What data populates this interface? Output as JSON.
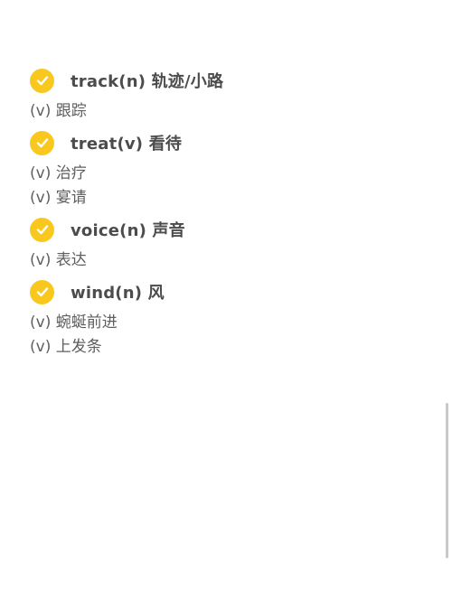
{
  "entries": [
    {
      "word": "track(n) 轨迹/小路",
      "senses": [
        "(v) 跟踪"
      ]
    },
    {
      "word": "treat(v) 看待",
      "senses": [
        "(v) 治疗",
        "(v) 宴请"
      ]
    },
    {
      "word": "voice(n) 声音",
      "senses": [
        "(v) 表达"
      ]
    },
    {
      "word": "wind(n) 风",
      "senses": [
        "(v) 蜿蜒前进",
        "(v) 上发条"
      ]
    }
  ],
  "colors": {
    "check_fill": "#f9c81e",
    "check_mark": "#ffffff",
    "word_text": "#4c4c4c",
    "sense_text": "#5f5f5f"
  },
  "icons": {
    "check": "check-circle-icon"
  }
}
